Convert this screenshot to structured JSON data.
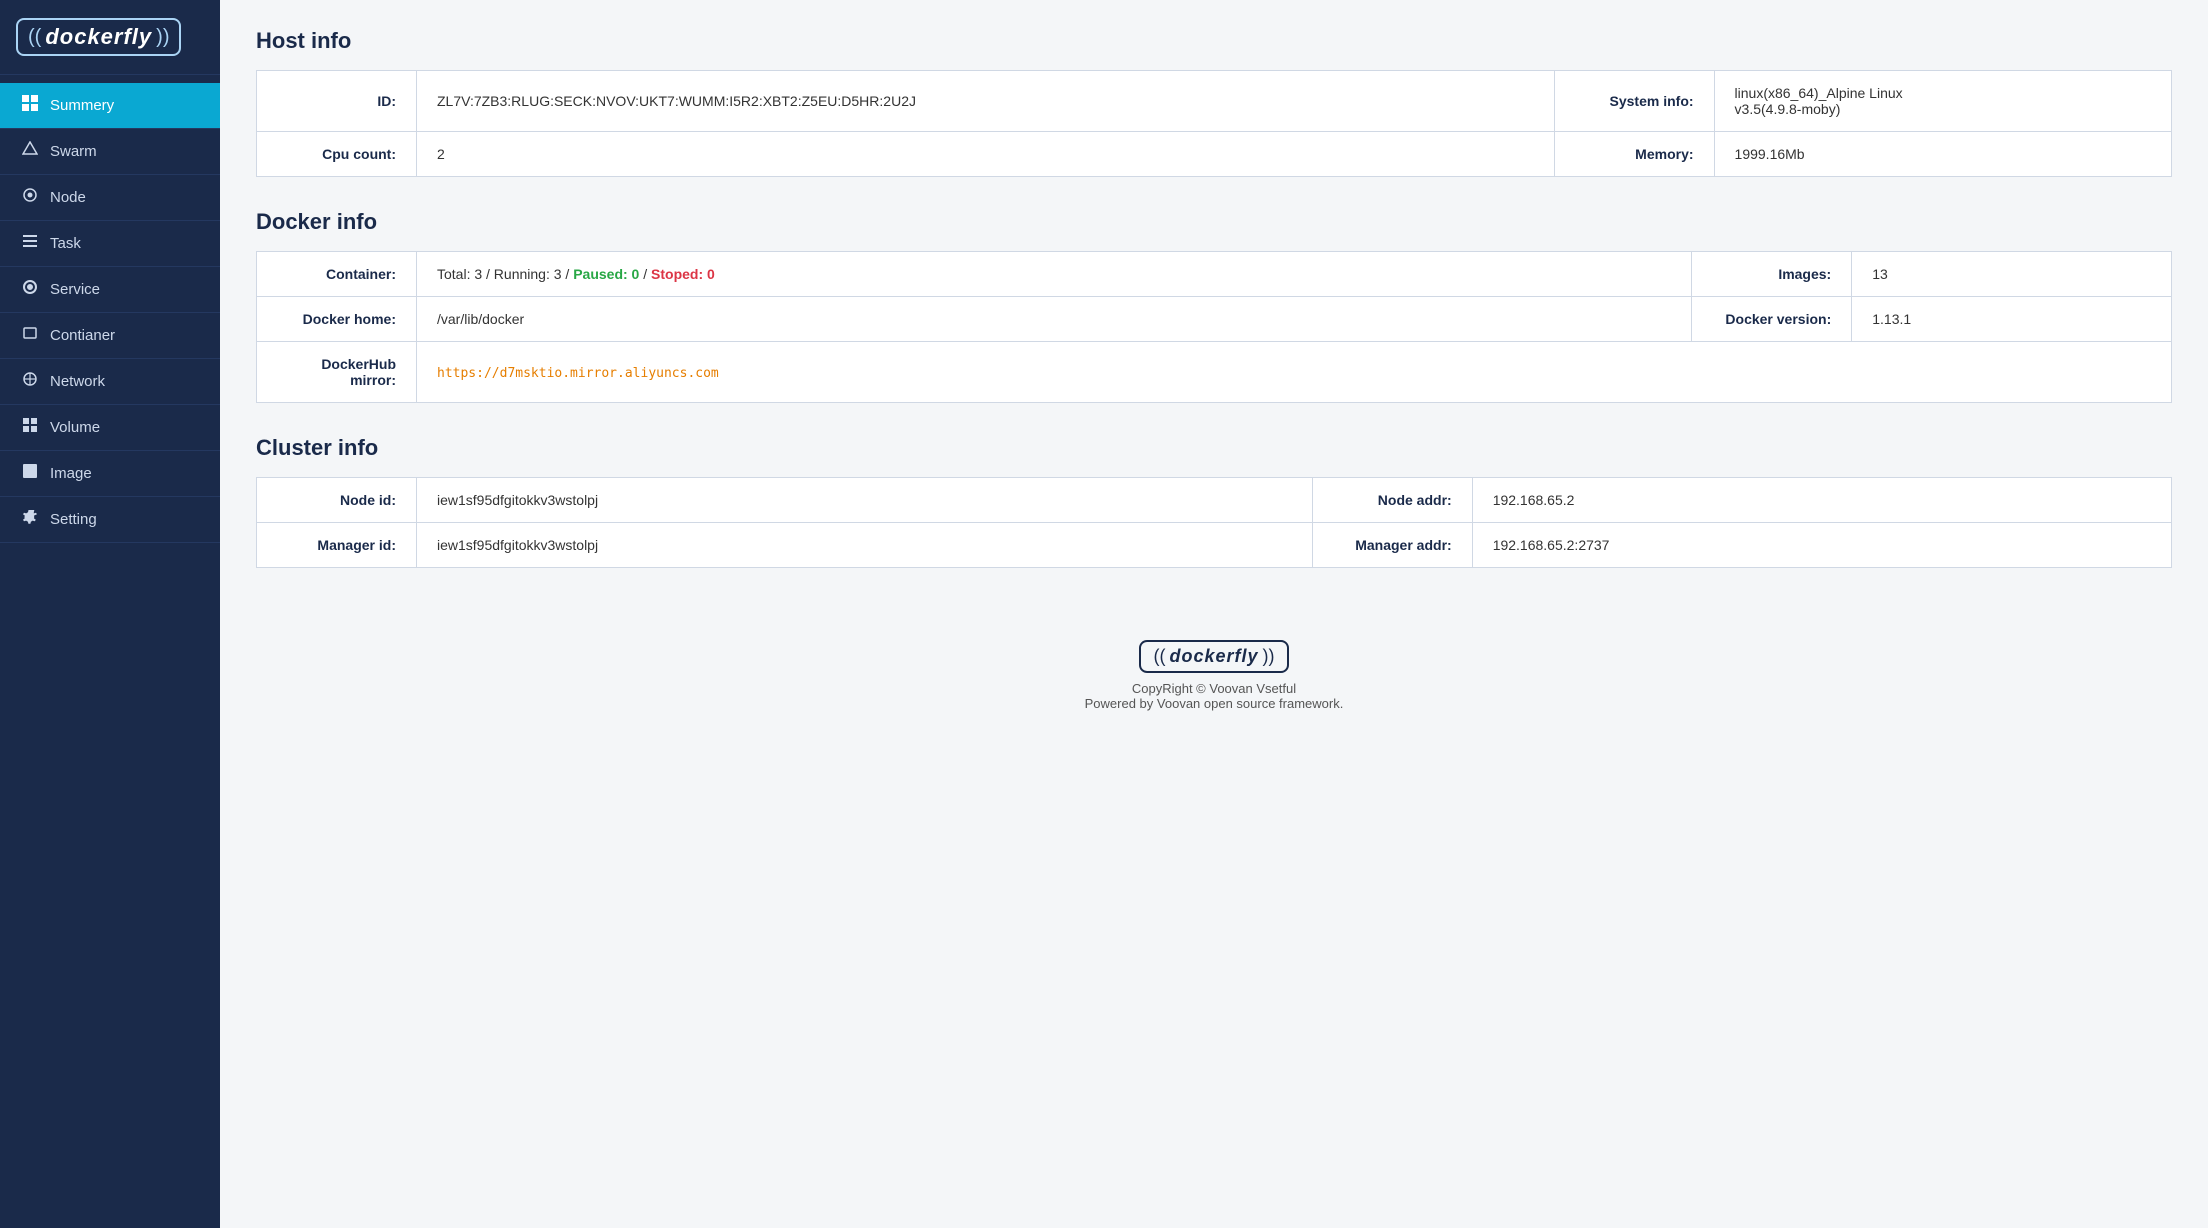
{
  "sidebar": {
    "logo": "dockerfly",
    "items": [
      {
        "id": "summery",
        "label": "Summery",
        "icon": "⊞",
        "active": true
      },
      {
        "id": "swarm",
        "label": "Swarm",
        "icon": "◇",
        "active": false
      },
      {
        "id": "node",
        "label": "Node",
        "icon": "⬡",
        "active": false
      },
      {
        "id": "task",
        "label": "Task",
        "icon": "☰",
        "active": false
      },
      {
        "id": "service",
        "label": "Service",
        "icon": "⚙",
        "active": false
      },
      {
        "id": "container",
        "label": "Contianer",
        "icon": "▭",
        "active": false
      },
      {
        "id": "network",
        "label": "Network",
        "icon": "⊕",
        "active": false
      },
      {
        "id": "volume",
        "label": "Volume",
        "icon": "⊞",
        "active": false
      },
      {
        "id": "image",
        "label": "Image",
        "icon": "⬛",
        "active": false
      },
      {
        "id": "setting",
        "label": "Setting",
        "icon": "⚙",
        "active": false
      }
    ]
  },
  "host_info": {
    "section_title": "Host info",
    "id_label": "ID:",
    "id_value": "ZL7V:7ZB3:RLUG:SECK:NVOV:UKT7:WUMM:I5R2:XBT2:Z5EU:D5HR:2U2J",
    "system_info_label": "System info:",
    "system_info_value": "linux(x86_64)_Alpine Linux v3.5(4.9.8-moby)",
    "cpu_count_label": "Cpu count:",
    "cpu_count_value": "2",
    "memory_label": "Memory:",
    "memory_value": "1999.16Mb"
  },
  "docker_info": {
    "section_title": "Docker info",
    "container_label": "Container:",
    "container_total": "Total: 3 / Running: 3 / ",
    "container_paused": "Paused: 0",
    "container_sep": " / ",
    "container_stopped": "Stoped: 0",
    "images_label": "Images:",
    "images_value": "13",
    "docker_home_label": "Docker home:",
    "docker_home_value": "/var/lib/docker",
    "docker_version_label": "Docker version:",
    "docker_version_value": "1.13.1",
    "dockerhub_label": "DockerHub mirror:",
    "dockerhub_value": "https://d7msktio.mirror.aliyuncs.com"
  },
  "cluster_info": {
    "section_title": "Cluster info",
    "node_id_label": "Node id:",
    "node_id_value": "iew1sf95dfgitokkv3wstolpj",
    "node_addr_label": "Node addr:",
    "node_addr_value": "192.168.65.2",
    "manager_id_label": "Manager id:",
    "manager_id_value": "iew1sf95dfgitokkv3wstolpj",
    "manager_addr_label": "Manager addr:",
    "manager_addr_value": "192.168.65.2:2737"
  },
  "footer": {
    "logo": "dockerfly",
    "copyright": "CopyRight © Voovan Vsetful",
    "powered": "Powered by Voovan open source framework."
  }
}
